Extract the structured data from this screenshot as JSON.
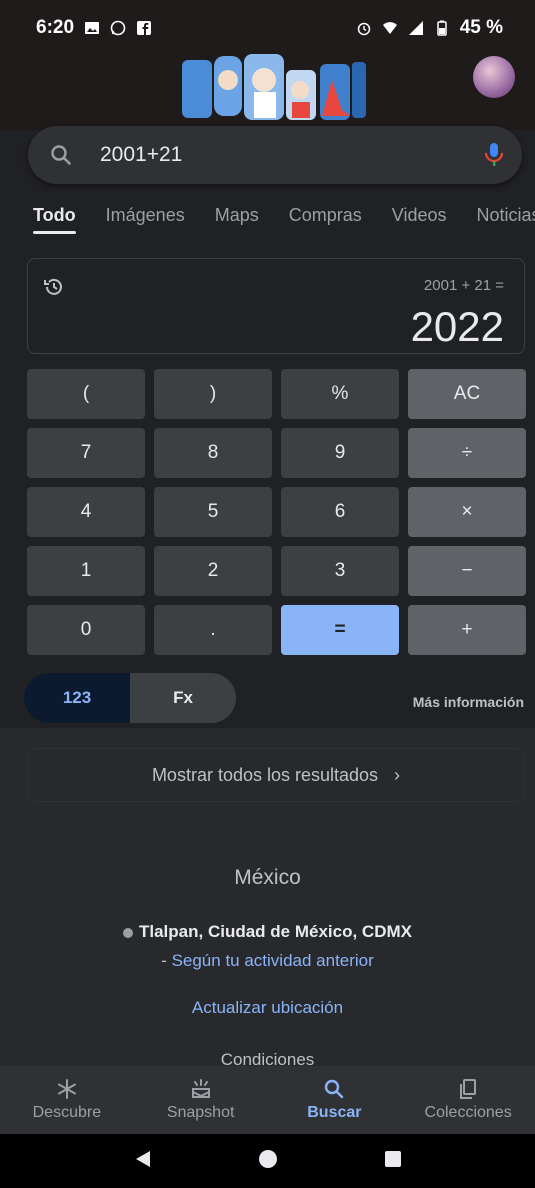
{
  "status_bar": {
    "time": "6:20",
    "battery": "45 %"
  },
  "search": {
    "query": "2001+21"
  },
  "tabs": [
    {
      "label": "Todo",
      "active": true
    },
    {
      "label": "Imágenes",
      "active": false
    },
    {
      "label": "Maps",
      "active": false
    },
    {
      "label": "Compras",
      "active": false
    },
    {
      "label": "Videos",
      "active": false
    },
    {
      "label": "Noticias",
      "active": false
    }
  ],
  "calculator": {
    "expression": "2001 + 21 =",
    "result": "2022",
    "keys": [
      {
        "label": "(",
        "kind": "num"
      },
      {
        "label": ")",
        "kind": "num"
      },
      {
        "label": "%",
        "kind": "num"
      },
      {
        "label": "AC",
        "kind": "op"
      },
      {
        "label": "7",
        "kind": "num"
      },
      {
        "label": "8",
        "kind": "num"
      },
      {
        "label": "9",
        "kind": "num"
      },
      {
        "label": "÷",
        "kind": "op"
      },
      {
        "label": "4",
        "kind": "num"
      },
      {
        "label": "5",
        "kind": "num"
      },
      {
        "label": "6",
        "kind": "num"
      },
      {
        "label": "×",
        "kind": "op"
      },
      {
        "label": "1",
        "kind": "num"
      },
      {
        "label": "2",
        "kind": "num"
      },
      {
        "label": "3",
        "kind": "num"
      },
      {
        "label": "−",
        "kind": "op"
      },
      {
        "label": "0",
        "kind": "num"
      },
      {
        "label": ".",
        "kind": "num"
      },
      {
        "label": "=",
        "kind": "eq"
      },
      {
        "label": "+",
        "kind": "op"
      }
    ],
    "mode_123": "123",
    "mode_fx": "Fx",
    "more_info": "Más información"
  },
  "results": {
    "show_all": "Mostrar todos los resultados",
    "chevron": "›"
  },
  "location": {
    "country": "México",
    "place": "Tlalpan, Ciudad de México, CDMX",
    "activity_prefix": "- ",
    "activity_link": "Según tu actividad anterior",
    "update": "Actualizar ubicación",
    "conditions": "Condiciones"
  },
  "bottom_nav": [
    {
      "label": "Descubre",
      "icon": "asterisk-icon",
      "active": false
    },
    {
      "label": "Snapshot",
      "icon": "snapshot-icon",
      "active": false
    },
    {
      "label": "Buscar",
      "icon": "search-icon",
      "active": true
    },
    {
      "label": "Colecciones",
      "icon": "collections-icon",
      "active": false
    }
  ],
  "colors": {
    "accent": "#8ab4f8",
    "background": "#202124",
    "key": "#3c4043",
    "operator_key": "#5f6368"
  }
}
